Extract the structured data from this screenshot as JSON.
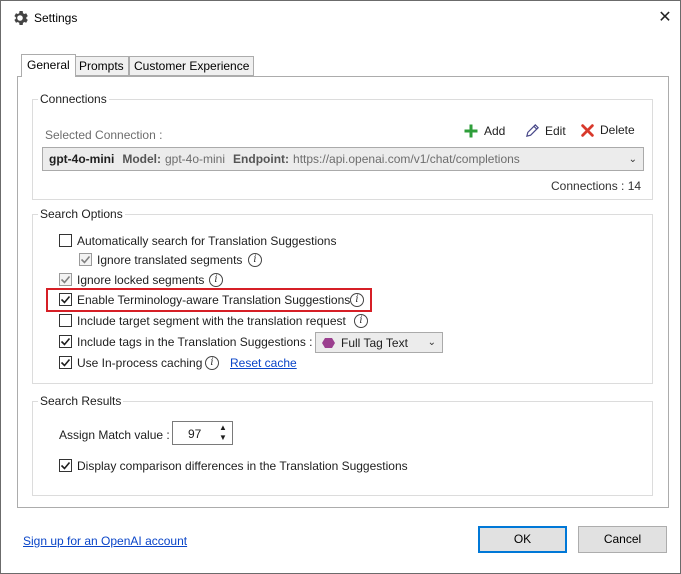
{
  "window": {
    "title": "Settings"
  },
  "tabs": [
    {
      "label": "General",
      "active": true
    },
    {
      "label": "Prompts",
      "active": false
    },
    {
      "label": "Customer Experience",
      "active": false
    }
  ],
  "connections": {
    "group_title": "Connections",
    "selected_label": "Selected Connection :",
    "add_label": "Add",
    "edit_label": "Edit",
    "delete_label": "Delete",
    "selected": {
      "name": "gpt-4o-mini",
      "model_label": "Model:",
      "model_value": "gpt-4o-mini",
      "endpoint_label": "Endpoint:",
      "endpoint_value": "https://api.openai.com/v1/chat/completions"
    },
    "count_text": "Connections : 14"
  },
  "search_options": {
    "group_title": "Search Options",
    "items": [
      {
        "label": "Automatically search for Translation Suggestions",
        "checked": false,
        "disabled": false,
        "info": false
      },
      {
        "label": "Ignore translated segments",
        "checked": true,
        "disabled": true,
        "info": true
      },
      {
        "label": "Ignore locked segments",
        "checked": true,
        "disabled": true,
        "info": true
      },
      {
        "label": "Enable Terminology-aware Translation Suggestions",
        "checked": true,
        "disabled": false,
        "info": true
      },
      {
        "label": "Include target segment with the translation request",
        "checked": false,
        "disabled": false,
        "info": true
      },
      {
        "label": "Include tags in the Translation Suggestions :",
        "checked": true,
        "disabled": false,
        "info": false
      },
      {
        "label": "Use In-process caching",
        "checked": true,
        "disabled": false,
        "info": true
      }
    ],
    "tag_mode_value": "Full Tag Text",
    "reset_cache_label": "Reset cache"
  },
  "search_results": {
    "group_title": "Search Results",
    "assign_match_label": "Assign Match value :",
    "assign_match_value": "97",
    "display_diff_label": "Display comparison differences in the Translation Suggestions",
    "display_diff_checked": true
  },
  "footer": {
    "signup_link": "Sign up for an OpenAI account",
    "ok_label": "OK",
    "cancel_label": "Cancel"
  },
  "colors": {
    "highlight_border": "#d61f26",
    "add_icon": "#2e9e3a",
    "delete_icon": "#d8392b",
    "link": "#0a45c8",
    "tag_icon": "#9b3f8f"
  },
  "icons": {
    "title": "gear-icon",
    "add": "plus-icon",
    "edit": "pencil-icon",
    "delete": "x-icon",
    "info": "info-icon",
    "tag": "tag-icon"
  }
}
